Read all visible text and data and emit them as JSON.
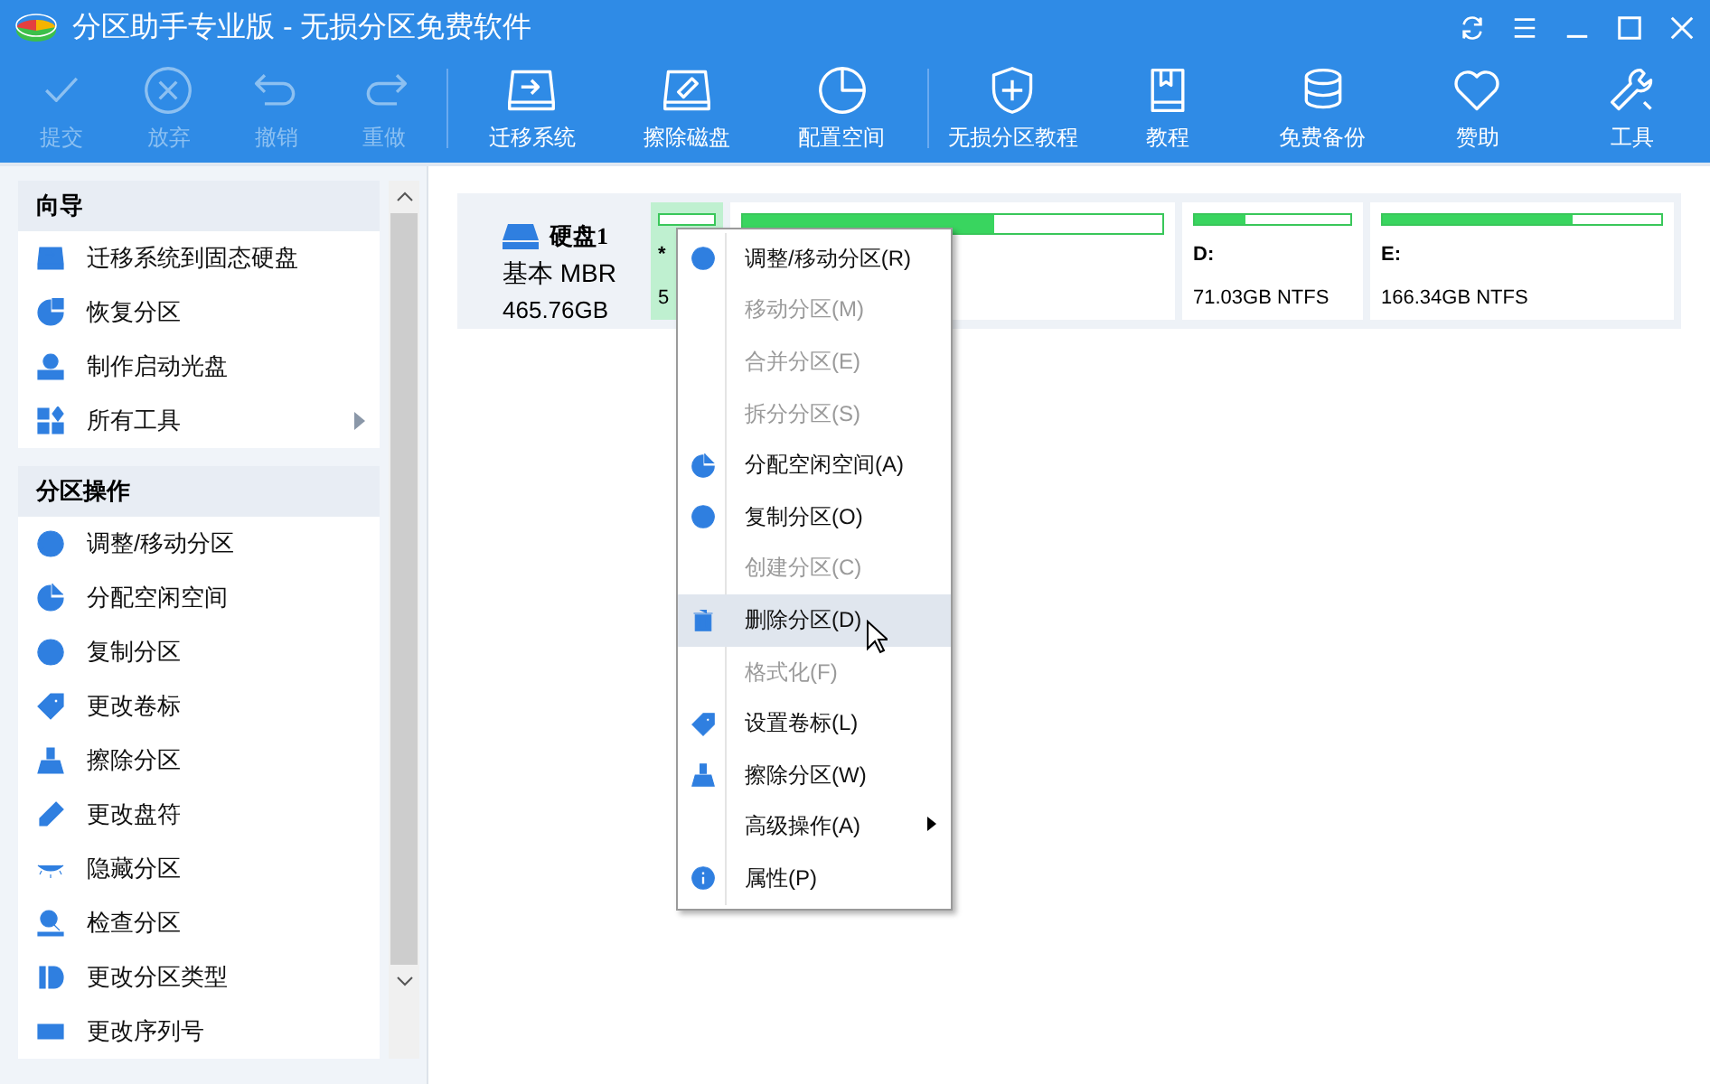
{
  "window": {
    "title": "分区助手专业版 - 无损分区免费软件"
  },
  "toolbar": [
    {
      "label": "提交",
      "disabled": true
    },
    {
      "label": "放弃",
      "disabled": true
    },
    {
      "label": "撤销",
      "disabled": true
    },
    {
      "label": "重做",
      "disabled": true
    },
    {
      "label": "迁移系统",
      "disabled": false
    },
    {
      "label": "擦除磁盘",
      "disabled": false
    },
    {
      "label": "配置空间",
      "disabled": false
    },
    {
      "label": "无损分区教程",
      "disabled": false
    },
    {
      "label": "教程",
      "disabled": false
    },
    {
      "label": "免费备份",
      "disabled": false
    },
    {
      "label": "赞助",
      "disabled": false
    },
    {
      "label": "工具",
      "disabled": false
    }
  ],
  "sidebar": [
    {
      "title": "向导",
      "items": [
        {
          "label": "迁移系统到固态硬盘",
          "has_submenu": false
        },
        {
          "label": "恢复分区",
          "has_submenu": false
        },
        {
          "label": "制作启动光盘",
          "has_submenu": false
        },
        {
          "label": "所有工具",
          "has_submenu": true
        }
      ]
    },
    {
      "title": "分区操作",
      "items": [
        {
          "label": "调整/移动分区",
          "has_submenu": false
        },
        {
          "label": "分配空闲空间",
          "has_submenu": false
        },
        {
          "label": "复制分区",
          "has_submenu": false
        },
        {
          "label": "更改卷标",
          "has_submenu": false
        },
        {
          "label": "擦除分区",
          "has_submenu": false
        },
        {
          "label": "更改盘符",
          "has_submenu": false
        },
        {
          "label": "隐藏分区",
          "has_submenu": false
        },
        {
          "label": "检查分区",
          "has_submenu": false
        },
        {
          "label": "更改分区类型",
          "has_submenu": false
        },
        {
          "label": "更改序列号",
          "has_submenu": false
        }
      ]
    }
  ],
  "disk": {
    "name": "硬盘1",
    "type": "基本 MBR",
    "size": "465.76GB",
    "partitions": [
      {
        "letter": "*",
        "info": "5",
        "level": 0,
        "selected": true
      },
      {
        "level": 0.6,
        "selected": false
      },
      {
        "letter": "D:",
        "info": "71.03GB NTFS",
        "level": 0.32,
        "selected": false
      },
      {
        "letter": "E:",
        "info": "166.34GB NTFS",
        "level": 0.68,
        "selected": false
      }
    ]
  },
  "context_menu": [
    {
      "label": "调整/移动分区(R)",
      "disabled": false,
      "highlighted": false,
      "has_submenu": false
    },
    {
      "label": "移动分区(M)",
      "disabled": true,
      "highlighted": false,
      "has_submenu": false
    },
    {
      "label": "合并分区(E)",
      "disabled": true,
      "highlighted": false,
      "has_submenu": false
    },
    {
      "label": "拆分分区(S)",
      "disabled": true,
      "highlighted": false,
      "has_submenu": false
    },
    {
      "label": "分配空闲空间(A)",
      "disabled": false,
      "highlighted": false,
      "has_submenu": false
    },
    {
      "label": "复制分区(O)",
      "disabled": false,
      "highlighted": false,
      "has_submenu": false
    },
    {
      "label": "创建分区(C)",
      "disabled": true,
      "highlighted": false,
      "has_submenu": false
    },
    {
      "label": "删除分区(D)",
      "disabled": false,
      "highlighted": true,
      "has_submenu": false
    },
    {
      "label": "格式化(F)",
      "disabled": true,
      "highlighted": false,
      "has_submenu": false
    },
    {
      "label": "设置卷标(L)",
      "disabled": false,
      "highlighted": false,
      "has_submenu": false
    },
    {
      "label": "擦除分区(W)",
      "disabled": false,
      "highlighted": false,
      "has_submenu": false
    },
    {
      "label": "高级操作(A)",
      "disabled": false,
      "highlighted": false,
      "has_submenu": true
    },
    {
      "label": "属性(P)",
      "disabled": false,
      "highlighted": false,
      "has_submenu": false
    }
  ]
}
